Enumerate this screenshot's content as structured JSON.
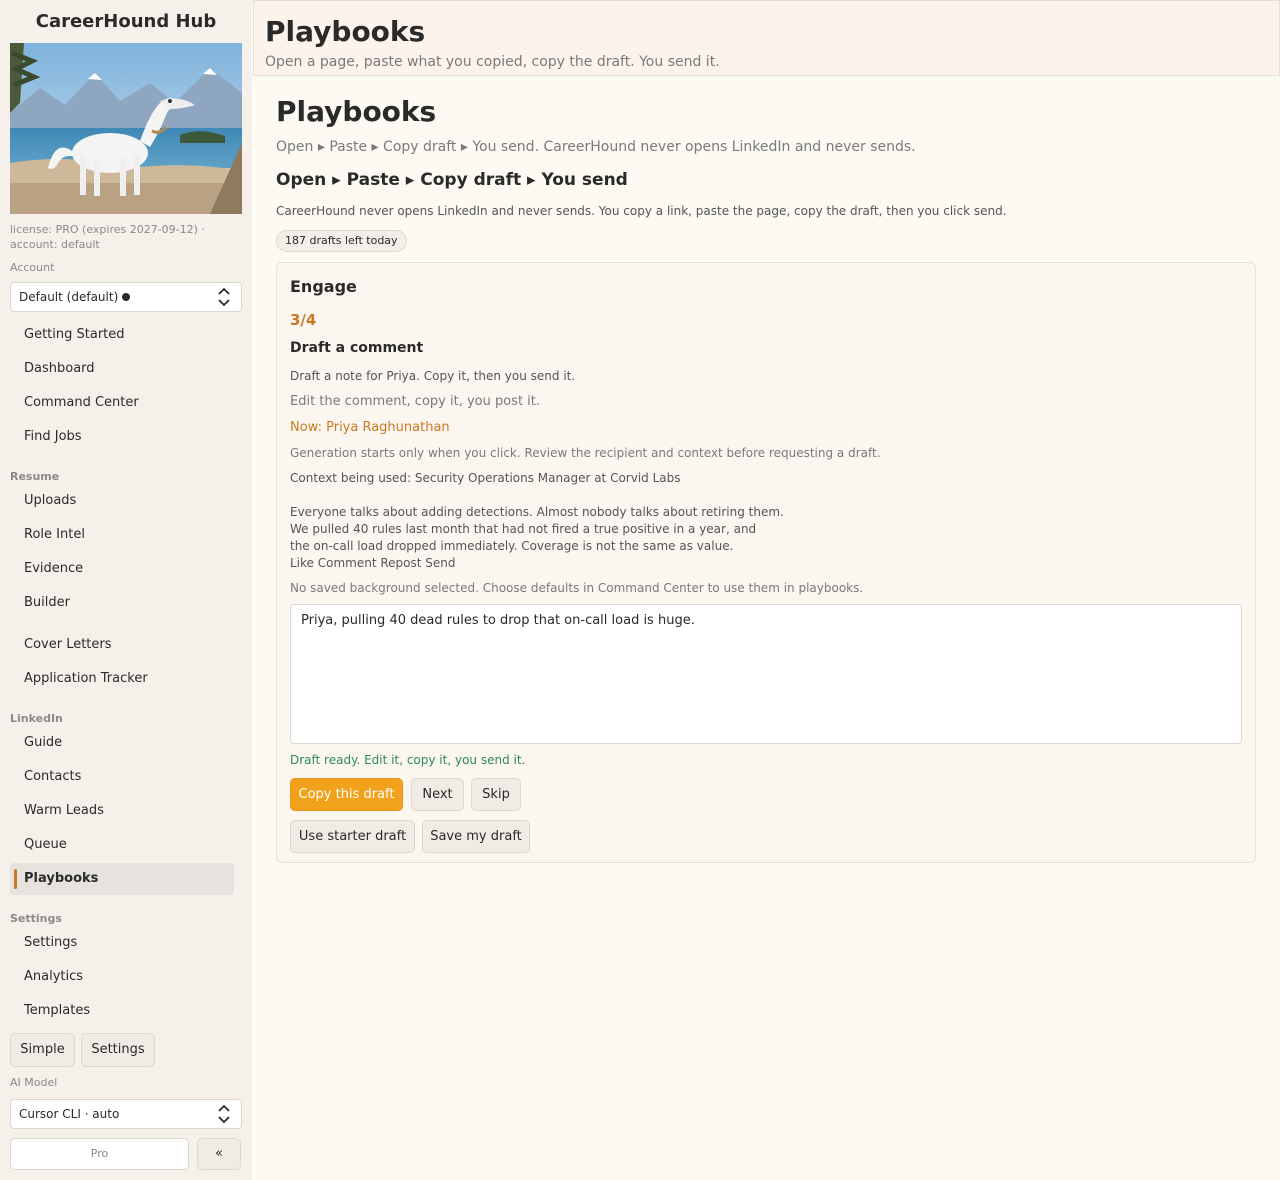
{
  "sidebar": {
    "brand": "CareerHound Hub",
    "license": "license: PRO (expires 2027-09-12) · account: default",
    "account_label": "Account",
    "account_value": "Default (default)",
    "nav_top": [
      "Getting Started",
      "Dashboard",
      "Command Center",
      "Find Jobs"
    ],
    "resume_label": "Resume",
    "nav_resume": [
      "Uploads",
      "Role Intel",
      "Evidence",
      "Builder"
    ],
    "nav_docs": [
      "Cover Letters",
      "Application Tracker"
    ],
    "linkedin_label": "LinkedIn",
    "nav_linkedin": [
      "Guide",
      "Contacts",
      "Warm Leads",
      "Queue",
      "Playbooks"
    ],
    "settings_label": "Settings",
    "nav_settings": [
      "Settings",
      "Analytics",
      "Templates"
    ],
    "simple_button": "Simple",
    "settings_button": "Settings",
    "ai_model_label": "AI Model",
    "ai_model_value": "Cursor CLI · auto",
    "pro_button": "Pro",
    "collapse_button": "«"
  },
  "header": {
    "title": "Playbooks",
    "subtitle": "Open a page, paste what you copied, copy the draft. You send it."
  },
  "main": {
    "title": "Playbooks",
    "subtitle": "Open ▸ Paste ▸ Copy draft ▸ You send. CareerHound never opens LinkedIn and never sends.",
    "flow_heading": "Open ▸ Paste ▸ Copy draft ▸ You send",
    "note": "CareerHound never opens LinkedIn and never sends. You copy a link, paste the page, copy the draft, then you click send.",
    "drafts_badge": "187 drafts left today"
  },
  "card": {
    "title": "Engage",
    "step": "3/4",
    "step_title": "Draft a comment",
    "instruction": "Draft a note for Priya. Copy it, then you send it.",
    "instruction2": "Edit the comment, copy it, you post it.",
    "now": "Now: Priya Raghunathan",
    "generation_note": "Generation starts only when you click. Review the recipient and context before requesting a draft.",
    "context": "Context being used: Security Operations Manager at Corvid Labs",
    "post_lines": [
      "Everyone talks about adding detections. Almost nobody talks about retiring them.",
      "We pulled 40 rules last month that had not fired a true positive in a year, and",
      "the on-call load dropped immediately. Coverage is not the same as value.",
      "Like Comment Repost Send"
    ],
    "background_note": "No saved background selected. Choose defaults in Command Center to use them in playbooks.",
    "draft_text": "Priya, pulling 40 dead rules to drop that on-call load is huge.",
    "ready_status": "Draft ready. Edit it, copy it, you send it.",
    "copy_button": "Copy this draft",
    "next_button": "Next",
    "skip_button": "Skip",
    "starter_button": "Use starter draft",
    "save_button": "Save my draft"
  },
  "colors": {
    "accent": "#f2a21a",
    "step_orange": "#c97a22",
    "success_green": "#2f8a5a"
  }
}
